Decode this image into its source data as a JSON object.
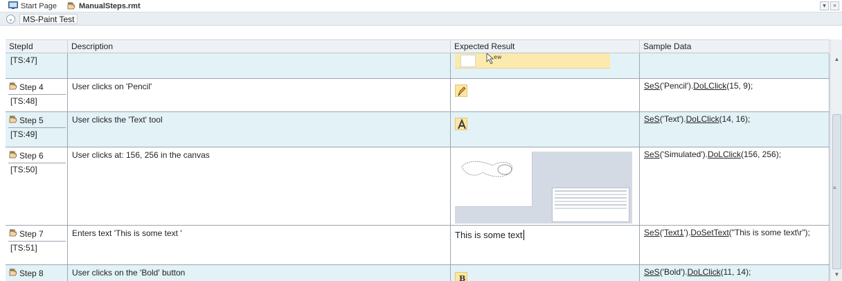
{
  "tabs": {
    "start_page": "Start Page",
    "file": "ManualSteps.rmt"
  },
  "window_controls": {
    "dropdown": "▾",
    "close": "×"
  },
  "subheader": {
    "collapse": "⌄",
    "title": "MS-Paint Test"
  },
  "columns": [
    "StepId",
    "Description",
    "Expected Result",
    "Sample Data"
  ],
  "rows": [
    {
      "step": "",
      "ts": "[TS:47]",
      "description": "",
      "expected": "image",
      "sample": ""
    },
    {
      "step": "Step 4",
      "ts": "[TS:48]",
      "description": "User clicks on 'Pencil'",
      "expected": "pencil-icon",
      "sample": {
        "a": "SeS",
        "b": "('Pencil').",
        "c": "DoLClick",
        "d": "(15, 9);"
      }
    },
    {
      "step": "Step 5",
      "ts": "[TS:49]",
      "description": "User clicks the 'Text' tool",
      "expected": "text-tool-icon",
      "sample": {
        "a": "SeS",
        "b": "('Text').",
        "c": "DoLClick",
        "d": "(14, 16);"
      }
    },
    {
      "step": "Step 6",
      "ts": "[TS:50]",
      "description": "User clicks at: 156, 256 in the canvas",
      "expected": "canvas-screenshot",
      "sample": {
        "a": "SeS",
        "b": "('Simulated').",
        "c": "DoLClick",
        "d": "(156, 256);"
      }
    },
    {
      "step": "Step 7",
      "ts": "[TS:51]",
      "description": "Enters text 'This is some text '",
      "expected_text": "This is some text",
      "sample": {
        "a": "SeS",
        "b": "('",
        "b2": "Text1",
        "b3": "').",
        "c": "DoSetText",
        "d": "(\"This is some text\\r\");"
      }
    },
    {
      "step": "Step 8",
      "ts": "",
      "description": "User clicks on the 'Bold' button",
      "expected": "bold-icon",
      "sample": {
        "a": "SeS",
        "b": "('Bold').",
        "c": "DoLClick",
        "d": "(11, 14);"
      }
    }
  ],
  "scrollbar": {
    "up": "▲",
    "down": "▼",
    "grip": "≡"
  },
  "colors": {
    "row_blue": "#e2f2f6",
    "header_bg": "#eef2f6",
    "grid_line": "#9aa5b1"
  },
  "icons": [
    "start-page-icon",
    "manual-steps-icon",
    "step-icon"
  ]
}
